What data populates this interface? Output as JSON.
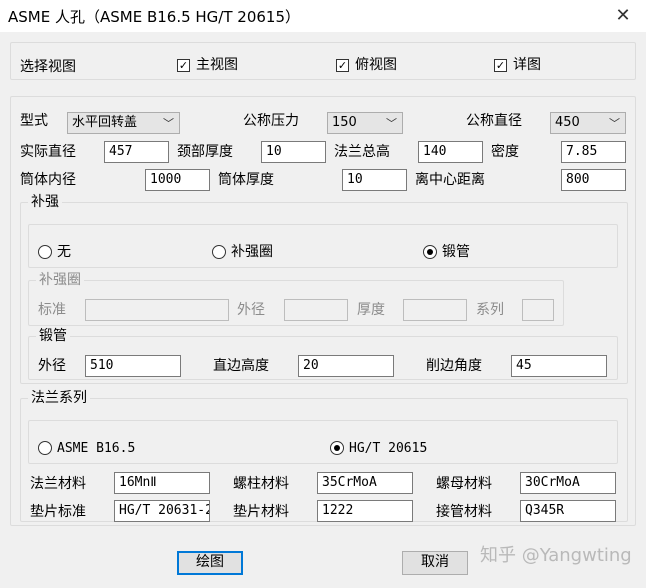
{
  "window": {
    "title": "ASME 人孔（ASME B16.5  HG/T 20615）",
    "close_glyph": "✕"
  },
  "views": {
    "label": "选择视图",
    "main": {
      "label": "主视图",
      "checked": true
    },
    "top": {
      "label": "俯视图",
      "checked": true
    },
    "detail": {
      "label": "详图",
      "checked": true
    }
  },
  "params": {
    "type_label": "型式",
    "type_value": "水平回转盖",
    "pressure_label": "公称压力",
    "pressure_value": "150",
    "dn_label": "公称直径",
    "dn_value": "450",
    "actual_dia_label": "实际直径",
    "actual_dia_value": "457",
    "neck_thk_label": "颈部厚度",
    "neck_thk_value": "10",
    "flange_height_label": "法兰总高",
    "flange_height_value": "140",
    "density_label": "密度",
    "density_value": "7.85",
    "shell_id_label": "筒体内径",
    "shell_id_value": "1000",
    "shell_thk_label": "筒体厚度",
    "shell_thk_value": "10",
    "center_dist_label": "离中心距离",
    "center_dist_value": "800"
  },
  "reinforce": {
    "group_label": "补强",
    "opt_none": "无",
    "opt_ring": "补强圈",
    "opt_forged": "锻管",
    "selected": "锻管",
    "ring": {
      "group_label": "补强圈",
      "standard_label": "标准",
      "standard_value": "",
      "od_label": "外径",
      "od_value": "",
      "thk_label": "厚度",
      "thk_value": "",
      "series_label": "系列",
      "series_value": ""
    },
    "forged": {
      "group_label": "锻管",
      "od_label": "外径",
      "od_value": "510",
      "straight_label": "直边高度",
      "straight_value": "20",
      "bevel_label": "削边角度",
      "bevel_value": "45"
    }
  },
  "flange": {
    "group_label": "法兰系列",
    "opt_asme": "ASME B16.5",
    "opt_hgt": "HG/T 20615",
    "selected": "HG/T 20615",
    "flange_mat_label": "法兰材料",
    "flange_mat_value": "16MnⅡ",
    "stud_mat_label": "螺柱材料",
    "stud_mat_value": "35CrMoA",
    "nut_mat_label": "螺母材料",
    "nut_mat_value": "30CrMoA",
    "gasket_std_label": "垫片标准",
    "gasket_std_value": "HG/T 20631-2",
    "gasket_mat_label": "垫片材料",
    "gasket_mat_value": "1222",
    "nozzle_mat_label": "接管材料",
    "nozzle_mat_value": "Q345R"
  },
  "buttons": {
    "draw": "绘图",
    "cancel": "取消"
  },
  "watermark": "知乎 @Yangwting",
  "icons": {
    "checkbox": "check-icon",
    "dropdown": "chevron-down-icon",
    "close": "close-icon"
  }
}
